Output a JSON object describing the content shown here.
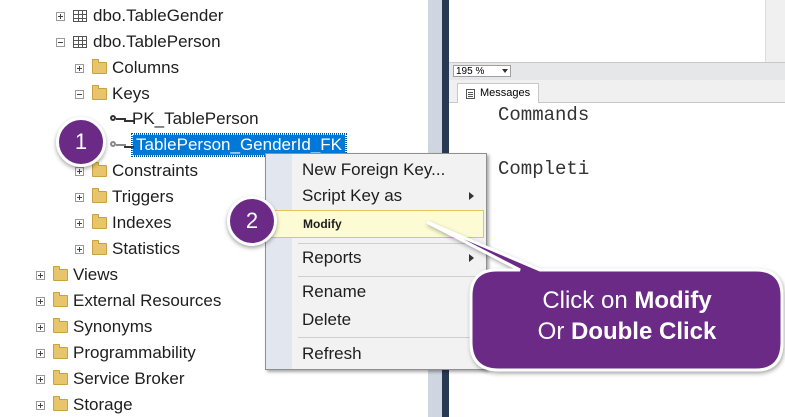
{
  "object_explorer": {
    "items": [
      {
        "label": "dbo.TableGender",
        "expander": "plus",
        "icon": "table-icon"
      },
      {
        "label": "dbo.TablePerson",
        "expander": "minus",
        "icon": "table-icon"
      },
      {
        "label": "Columns",
        "expander": "plus",
        "icon": "folder-icon"
      },
      {
        "label": "Keys",
        "expander": "minus",
        "icon": "folder-icon"
      },
      {
        "label": "PK_TablePerson",
        "icon": "primary-key-icon"
      },
      {
        "label": "TablePerson_GenderId_FK",
        "icon": "foreign-key-icon",
        "selected": true
      },
      {
        "label": "Constraints",
        "expander": "plus",
        "icon": "folder-icon"
      },
      {
        "label": "Triggers",
        "expander": "plus",
        "icon": "folder-icon"
      },
      {
        "label": "Indexes",
        "expander": "plus",
        "icon": "folder-icon"
      },
      {
        "label": "Statistics",
        "expander": "plus",
        "icon": "folder-icon"
      },
      {
        "label": "Views",
        "expander": "plus",
        "icon": "folder-icon"
      },
      {
        "label": "External Resources",
        "expander": "plus",
        "icon": "folder-icon"
      },
      {
        "label": "Synonyms",
        "expander": "plus",
        "icon": "folder-icon"
      },
      {
        "label": "Programmability",
        "expander": "plus",
        "icon": "folder-icon"
      },
      {
        "label": "Service Broker",
        "expander": "plus",
        "icon": "folder-icon"
      },
      {
        "label": "Storage",
        "expander": "plus",
        "icon": "folder-icon"
      }
    ]
  },
  "editor": {
    "zoom": "195 %",
    "tab_messages": "Messages",
    "line1": "Commands",
    "line2": "Completi"
  },
  "context_menu": {
    "items": [
      {
        "label": "New Foreign Key..."
      },
      {
        "label": "Script Key as",
        "submenu": true
      },
      {
        "label": "Modify",
        "highlighted": true
      },
      {
        "label": "Reports",
        "submenu": true
      },
      {
        "label": "Rename"
      },
      {
        "label": "Delete"
      },
      {
        "label": "Refresh"
      }
    ]
  },
  "callouts": {
    "step1": "1",
    "step2": "2",
    "tooltip_line1_prefix": "Click on ",
    "tooltip_line1_bold": "Modify",
    "tooltip_line2_prefix": "Or ",
    "tooltip_line2_bold": "Double Click"
  },
  "colors": {
    "selection": "#0078d7",
    "callout_purple": "#6a2a86",
    "menu_highlight": "#fdfbd4"
  }
}
